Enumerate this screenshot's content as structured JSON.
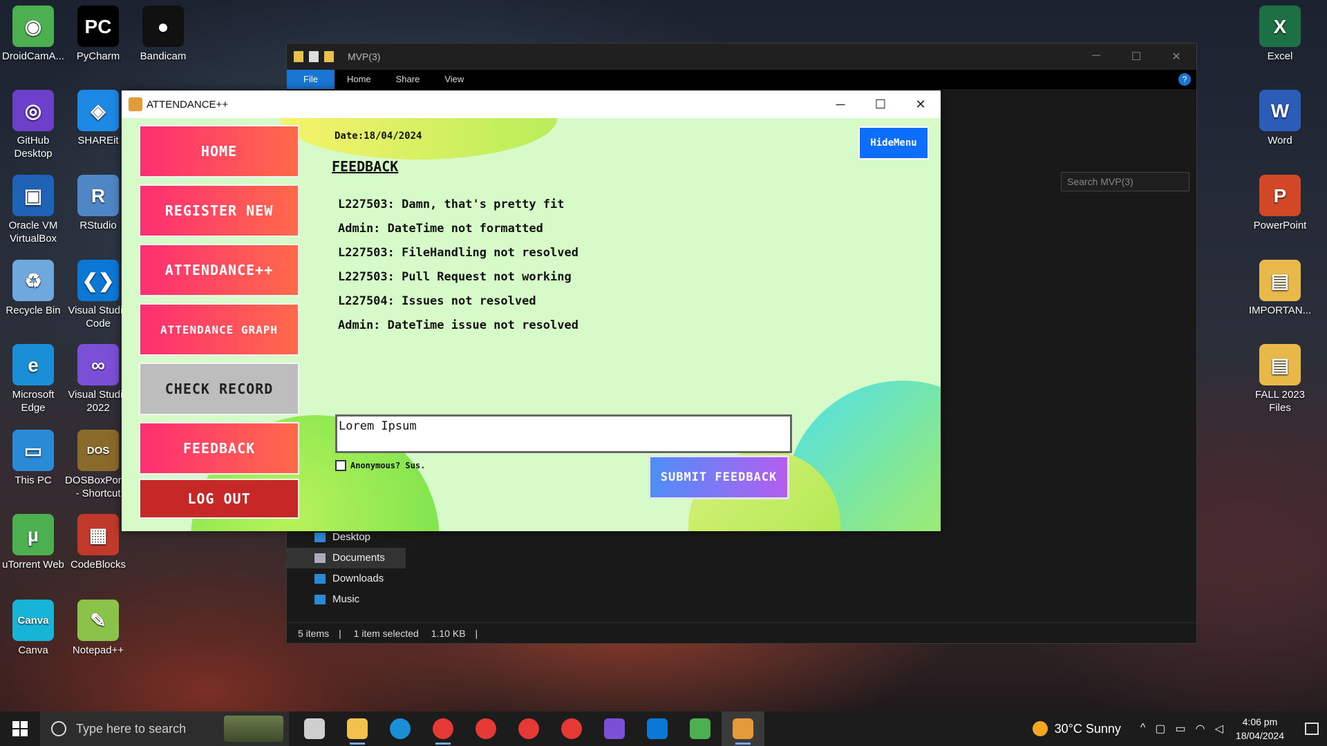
{
  "desktop": {
    "left_icons": [
      {
        "label": "DroidCamA...",
        "color": "#4caf50",
        "glyph": "◉"
      },
      {
        "label": "PyCharm",
        "color": "#000000",
        "glyph": "PC"
      },
      {
        "label": "Bandicam",
        "color": "#111111",
        "glyph": "●"
      },
      {
        "label": "GitHub Desktop",
        "color": "#6e40c9",
        "glyph": "◎"
      },
      {
        "label": "SHAREit",
        "color": "#1e88e5",
        "glyph": "◈"
      },
      {
        "label": "Oracle VM VirtualBox",
        "color": "#1e63b5",
        "glyph": "▣"
      },
      {
        "label": "RStudio",
        "color": "#4f86c6",
        "glyph": "R"
      },
      {
        "label": "Recycle Bin",
        "color": "#6fa8dc",
        "glyph": "♻"
      },
      {
        "label": "Visual Studio Code",
        "color": "#0a78d4",
        "glyph": "❮❯"
      },
      {
        "label": "Microsoft Edge",
        "color": "#1a8fd6",
        "glyph": "e"
      },
      {
        "label": "Visual Studio 2022",
        "color": "#7b4fd6",
        "glyph": "∞"
      },
      {
        "label": "This PC",
        "color": "#2b8ad6",
        "glyph": "▭"
      },
      {
        "label": "DOSBoxPortable - Shortcut",
        "color": "#8a6a2a",
        "glyph": "DOS"
      },
      {
        "label": "uTorrent Web",
        "color": "#4caf50",
        "glyph": "µ"
      },
      {
        "label": "CodeBlocks",
        "color": "#c0392b",
        "glyph": "▦"
      },
      {
        "label": "Canva",
        "color": "#18b4d8",
        "glyph": "Canva"
      },
      {
        "label": "Notepad++",
        "color": "#8bc34a",
        "glyph": "✎"
      }
    ],
    "right_icons": [
      {
        "label": "Excel",
        "color": "#1d7044",
        "glyph": "X"
      },
      {
        "label": "Word",
        "color": "#2b5cb8",
        "glyph": "W"
      },
      {
        "label": "PowerPoint",
        "color": "#d24726",
        "glyph": "P"
      },
      {
        "label": "IMPORTAN...",
        "color": "#e8b84a",
        "glyph": "▤"
      },
      {
        "label": "FALL 2023 Files",
        "color": "#e8b84a",
        "glyph": "▤"
      }
    ]
  },
  "explorer": {
    "title": "MVP(3)",
    "tabs": [
      "File",
      "Home",
      "Share",
      "View"
    ],
    "search_placeholder": "Search MVP(3)",
    "nav_items": [
      "Desktop",
      "Documents",
      "Downloads",
      "Music"
    ],
    "status": {
      "items": "5 items",
      "selected": "1 item selected",
      "size": "1.10 KB"
    }
  },
  "app": {
    "title": "ATTENDANCE++",
    "menu": {
      "home": "HOME",
      "register": "REGISTER NEW",
      "attendance": "ATTENDANCE++",
      "graph": "ATTENDANCE GRAPH",
      "check": "CHECK RECORD",
      "feedback": "FEEDBACK",
      "logout": "LOG OUT"
    },
    "date": "Date:18/04/2024",
    "heading": "FEEDBACK",
    "hide_menu": "HideMenu",
    "feedback_items": [
      "L227503: Damn, that's pretty fit",
      "Admin: DateTime not formatted",
      "L227503: FileHandling not resolved",
      "L227503: Pull Request not working",
      "L227504: Issues not resolved",
      "Admin: DateTime issue not resolved"
    ],
    "input_value": "Lorem Ipsum",
    "anonymous_label": "Anonymous? Sus.",
    "submit_label": "SUBMIT FEEDBACK"
  },
  "taskbar": {
    "search_placeholder": "Type here to search",
    "weather": "30°C  Sunny",
    "time": "4:06 pm",
    "date": "18/04/2024",
    "apps": [
      {
        "name": "task-view",
        "color": "#cfcfcf",
        "running": false
      },
      {
        "name": "file-explorer",
        "color": "#f2c14e",
        "running": true
      },
      {
        "name": "edge",
        "color": "#1a8fd6",
        "running": false
      },
      {
        "name": "chrome-1",
        "color": "#e53935",
        "running": true
      },
      {
        "name": "chrome-2",
        "color": "#e53935",
        "running": false
      },
      {
        "name": "chrome-3",
        "color": "#e53935",
        "running": false
      },
      {
        "name": "chrome-4",
        "color": "#e53935",
        "running": false
      },
      {
        "name": "visual-studio",
        "color": "#7b4fd6",
        "running": false
      },
      {
        "name": "vscode",
        "color": "#0a78d4",
        "running": false
      },
      {
        "name": "droidcam",
        "color": "#4caf50",
        "running": false
      },
      {
        "name": "attendance-app",
        "color": "#e59a3a",
        "running": true
      }
    ]
  }
}
